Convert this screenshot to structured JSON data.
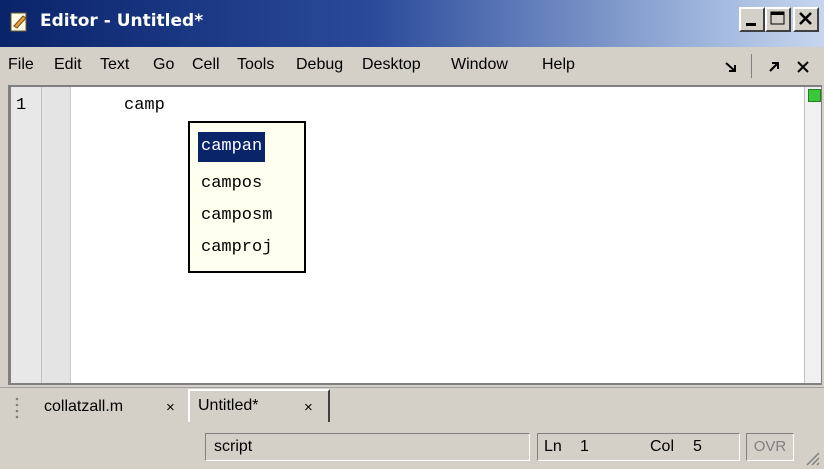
{
  "window": {
    "title": "Editor - Untitled*"
  },
  "menu": {
    "items": [
      "File",
      "Edit",
      "Text",
      "Go",
      "Cell",
      "Tools",
      "Debug",
      "Desktop",
      "Window",
      "Help"
    ]
  },
  "editor": {
    "line_number": "1",
    "code": "camp",
    "completions": [
      "campan",
      "campos",
      "camposm",
      "camproj"
    ],
    "selected_completion": "campan"
  },
  "tabs": [
    {
      "label": "collatzall.m",
      "close": "×"
    },
    {
      "label": "Untitled*",
      "close": "×"
    }
  ],
  "status": {
    "mode": "script",
    "ln_label": "Ln",
    "ln": "1",
    "col_label": "Col",
    "col": "5",
    "ovr": "OVR"
  },
  "colors": {
    "selection": "#0a246a",
    "title_start": "#0a246a",
    "popup_bg": "#fffff0"
  }
}
